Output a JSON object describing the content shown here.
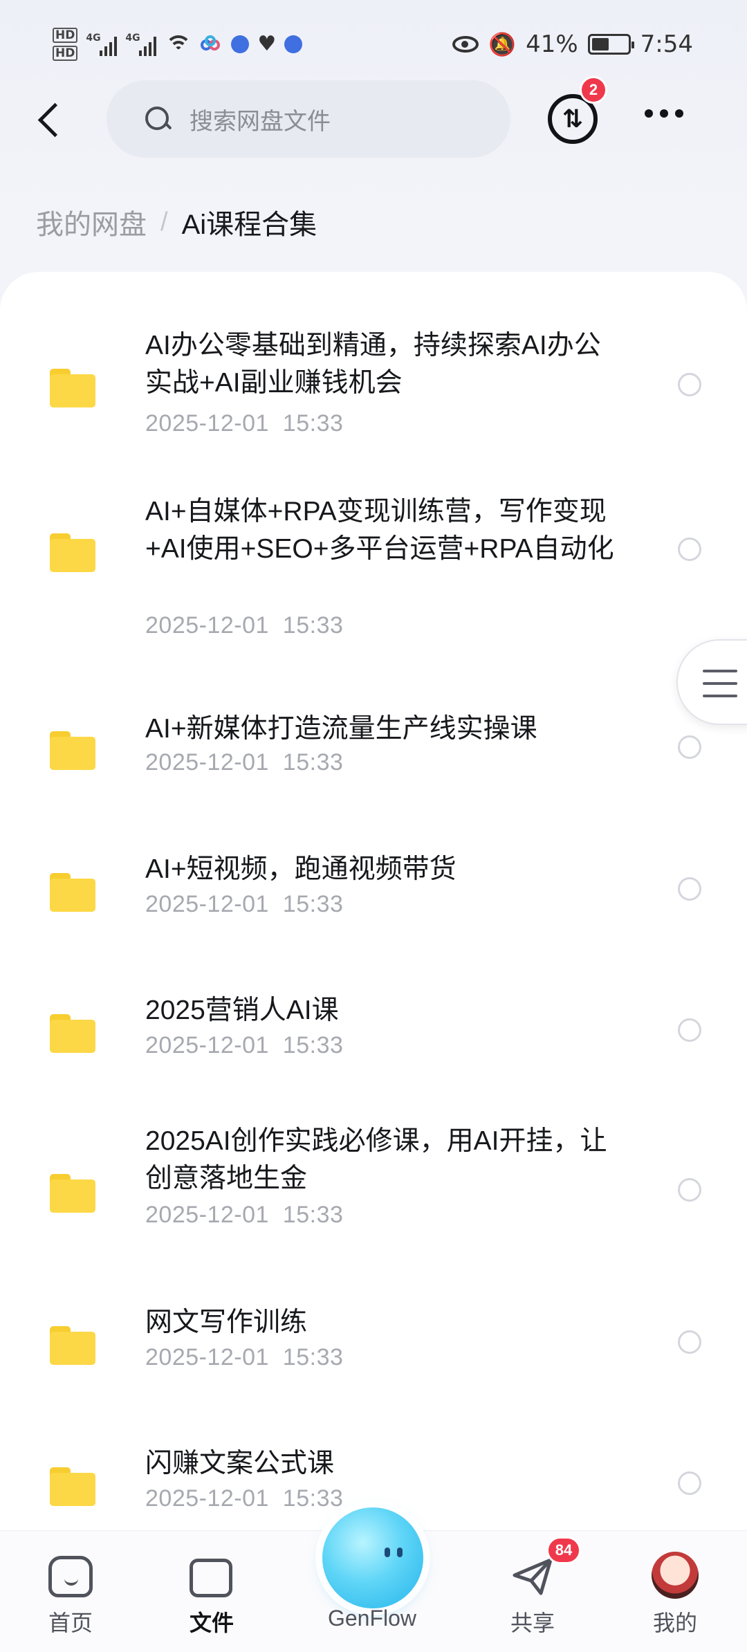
{
  "status_bar": {
    "hd1": "HD",
    "hd2": "HD",
    "net1": "4G",
    "net2": "4G",
    "battery_percent": "41%",
    "time": "7:54"
  },
  "topbar": {
    "search_placeholder": "搜索网盘文件",
    "transfer_badge": "2"
  },
  "breadcrumb": {
    "root": "我的网盘",
    "separator": "/",
    "current": "Ai课程合集"
  },
  "files": [
    {
      "name": "AI办公零基础到精通，持续探索AI办公实战+AI副业赚钱机会",
      "date": "2025-12-01  15:33"
    },
    {
      "name": "AI+自媒体+RPA变现训练营，写作变现+AI使用+SEO+多平台运营+RPA自动化",
      "date": "2025-12-01  15:33"
    },
    {
      "name": "AI+新媒体打造流量生产线实操课",
      "date": "2025-12-01  15:33"
    },
    {
      "name": "AI+短视频，跑通视频带货",
      "date": "2025-12-01  15:33"
    },
    {
      "name": "2025营销人AI课",
      "date": "2025-12-01  15:33"
    },
    {
      "name": "2025AI创作实践必修课，用AI开挂，让创意落地生金",
      "date": "2025-12-01  15:33"
    },
    {
      "name": "网文写作训练",
      "date": "2025-12-01  15:33"
    },
    {
      "name": "闪赚文案公式课",
      "date": "2025-12-01  15:33"
    }
  ],
  "bottom_nav": {
    "home": "首页",
    "files": "文件",
    "genflow": "GenFlow",
    "share": "共享",
    "share_badge": "84",
    "mine": "我的"
  },
  "colors": {
    "folder": "#fcd846",
    "badge": "#f0384c",
    "genflow": "#5fd5f7"
  }
}
